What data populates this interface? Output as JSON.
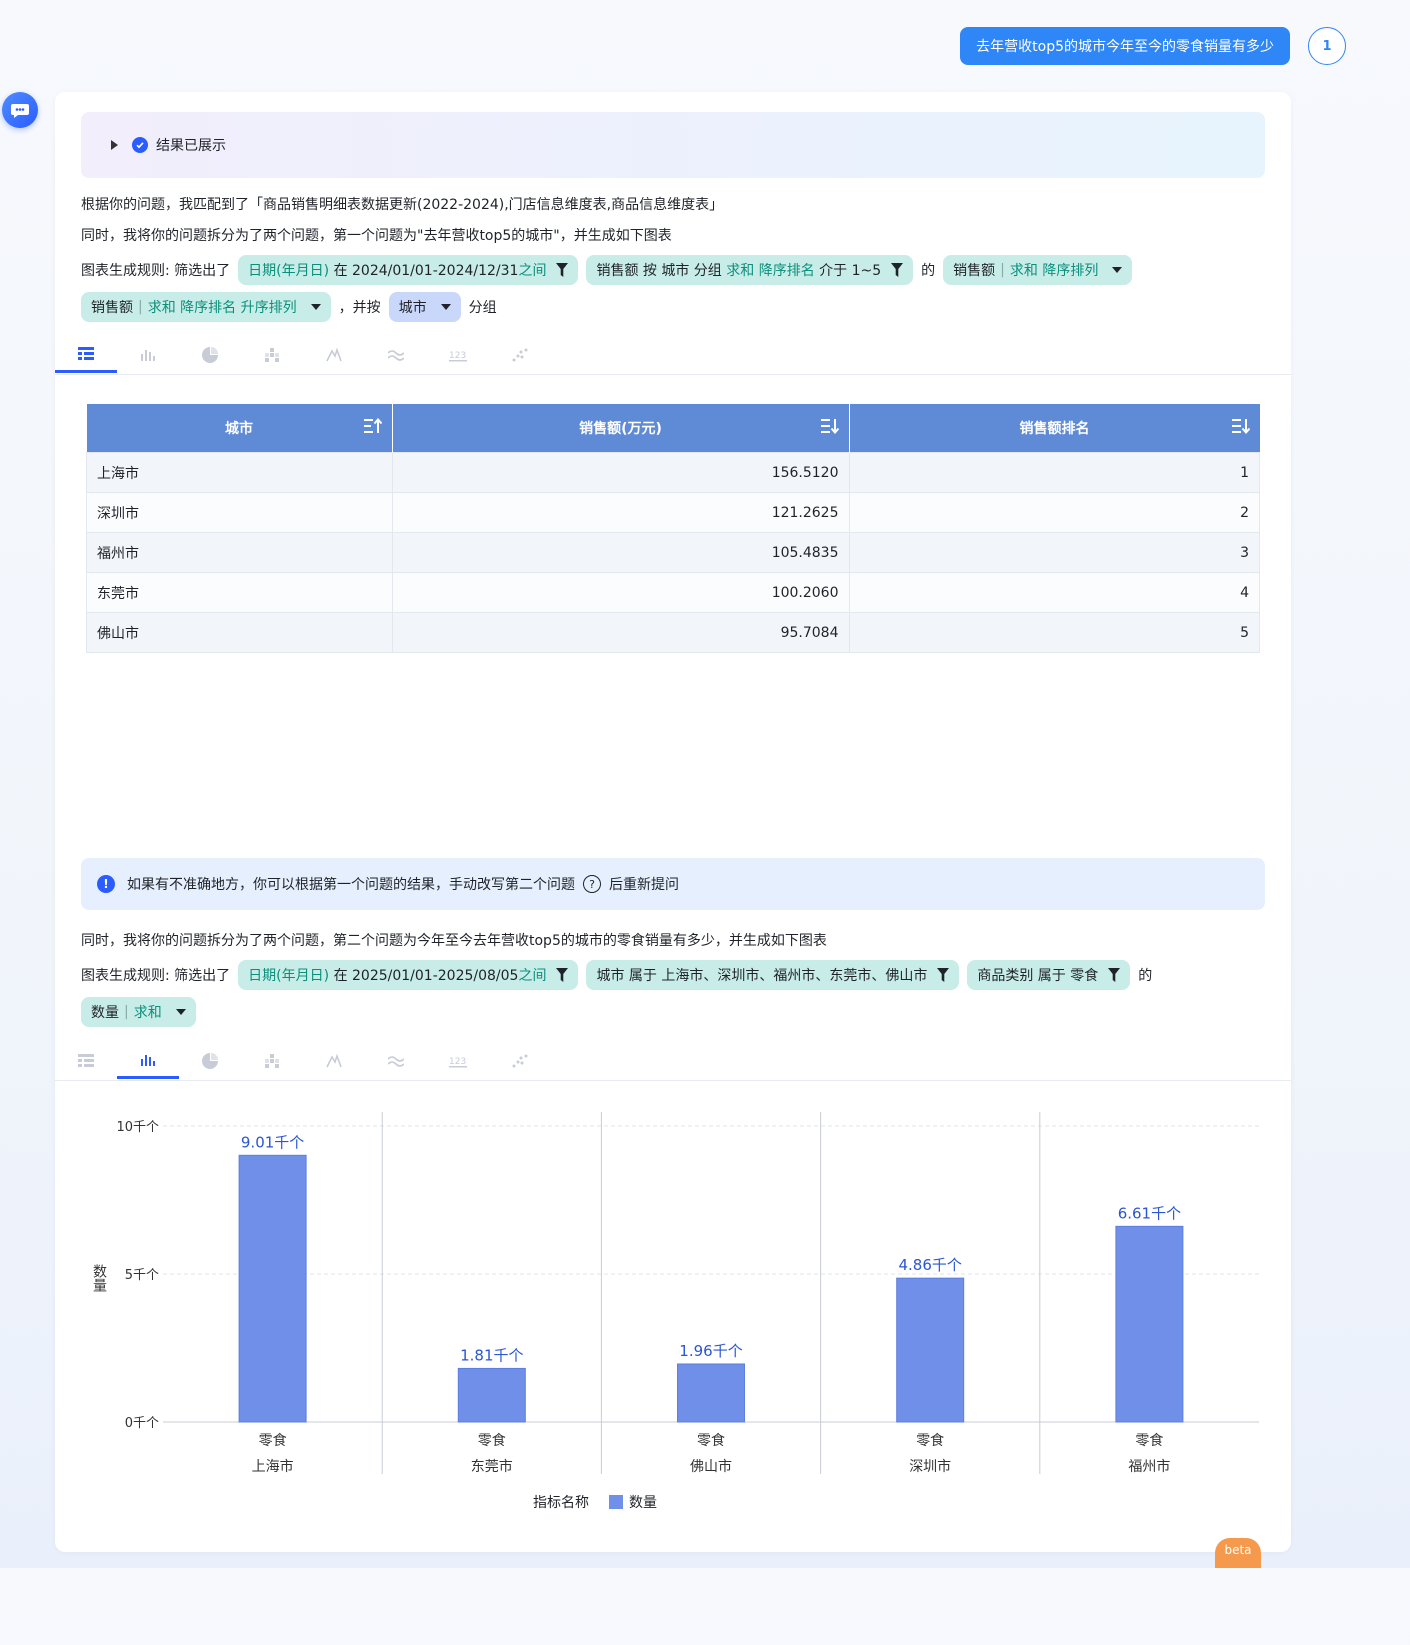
{
  "user_question": "去年营收top5的城市今年至今的零食销量有多少",
  "question_badge": "1",
  "status_label": "结果已展示",
  "intro_line1": "根据你的问题，我匹配到了「商品销售明细表数据更新(2022-2024),门店信息维度表,商品信息维度表」",
  "intro_line2": "同时，我将你的问题拆分为了两个问题，第一个问题为\"去年营收top5的城市\"，并生成如下图表",
  "rule_prefix": "图表生成规则:  筛选出了",
  "q1_rules": {
    "chip1_a": "日期(年月日)",
    "chip1_b": "在 2024/01/01-2024/12/31",
    "chip1_c": "之间",
    "chip2_a": "销售额 按 城市 分组",
    "chip2_b": "求和 降序排名",
    "chip2_c": "介于 1~5",
    "de": "的",
    "chip3_a": "销售额",
    "chip3_b": "求和 降序排列",
    "chip4_a": "销售额",
    "chip4_b": "求和 降序排名 升序排列",
    "and_by": "，并按",
    "chip5": "城市",
    "group": "分组"
  },
  "table": {
    "headers": [
      "城市",
      "销售额(万元)",
      "销售额排名"
    ],
    "rows": [
      [
        "上海市",
        "156.5120",
        "1"
      ],
      [
        "深圳市",
        "121.2625",
        "2"
      ],
      [
        "福州市",
        "105.4835",
        "3"
      ],
      [
        "东莞市",
        "100.2060",
        "4"
      ],
      [
        "佛山市",
        "95.7084",
        "5"
      ]
    ]
  },
  "notice": {
    "text_a": "如果有不准确地方，你可以根据第一个问题的结果，手动改写第二个问题",
    "text_b": "后重新提问"
  },
  "q2_line": "同时，我将你的问题拆分为了两个问题，第二个问题为今年至今去年营收top5的城市的零食销量有多少，并生成如下图表",
  "q2_rules": {
    "chip1_a": "日期(年月日)",
    "chip1_b": "在 2025/01/01-2025/08/05",
    "chip1_c": "之间",
    "chip2": "城市 属于 上海市、深圳市、福州市、东莞市、佛山市",
    "chip3": "商品类别 属于 零食",
    "de": "的",
    "chip4_a": "数量",
    "chip4_b": "求和"
  },
  "chart_data": {
    "type": "bar",
    "categories": [
      [
        "零食",
        "上海市"
      ],
      [
        "零食",
        "东莞市"
      ],
      [
        "零食",
        "佛山市"
      ],
      [
        "零食",
        "深圳市"
      ],
      [
        "零食",
        "福州市"
      ]
    ],
    "values": [
      9010,
      1810,
      1960,
      4860,
      6610
    ],
    "labels": [
      "9.01千个",
      "1.81千个",
      "1.96千个",
      "4.86千个",
      "6.61千个"
    ],
    "ylabel": "数量",
    "yticks": [
      "0千个",
      "5千个",
      "10千个"
    ],
    "ylim": [
      0,
      10000
    ],
    "legend_title": "指标名称",
    "legend": [
      "数量"
    ],
    "bar_color": "#6f8fe8",
    "label_color": "#2a55d4"
  },
  "beta": "beta"
}
